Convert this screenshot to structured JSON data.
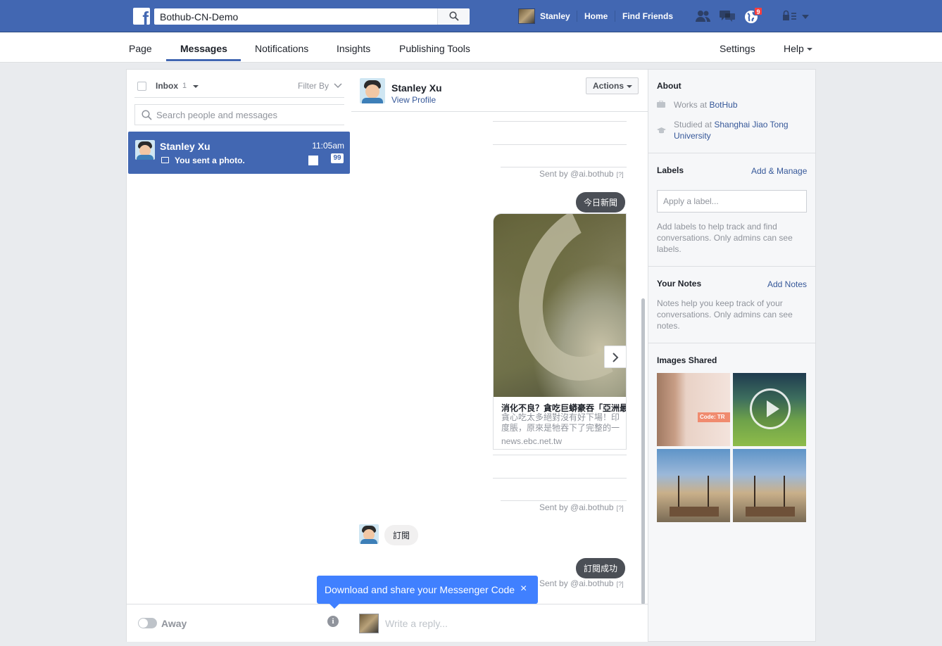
{
  "topbar": {
    "search_value": "Bothub-CN-Demo",
    "user_name": "Stanley",
    "home": "Home",
    "find_friends": "Find Friends",
    "notification_count": "9"
  },
  "subnav": {
    "tabs": [
      "Page",
      "Messages",
      "Notifications",
      "Insights",
      "Publishing Tools"
    ],
    "active_tab": "Messages",
    "settings": "Settings",
    "help": "Help"
  },
  "inbox": {
    "label": "Inbox",
    "count": "1",
    "filter": "Filter By",
    "search_placeholder": "Search people and messages",
    "conversations": [
      {
        "name": "Stanley Xu",
        "time": "11:05am",
        "snippet": "You sent a photo.",
        "badge": "99"
      }
    ],
    "status": "Away"
  },
  "conversation": {
    "name": "Stanley Xu",
    "view_profile": "View Profile",
    "actions": "Actions",
    "sent_by": "Sent by @ai.bothub",
    "sent_by_q": "[?]",
    "bubble_news": "今日新聞",
    "card": {
      "title": "消化不良？貪吃巨蟒豪吞「亞洲最",
      "desc": "貪心吃太多絕對沒有好下場！印度脹，原來是牠吞下了完整的一隻「",
      "domain": "news.ebc.net.tw"
    },
    "user_reply": "訂閱",
    "bubble_success": "訂閱成功",
    "reply_placeholder": "Write a reply..."
  },
  "tooltip": {
    "text": "Download and share your Messenger Code",
    "close": "×"
  },
  "about": {
    "title": "About",
    "works_prefix": "Works at ",
    "works_link": "BotHub",
    "studied_prefix": "Studied at ",
    "studied_link": "Shanghai Jiao Tong University"
  },
  "labels": {
    "title": "Labels",
    "manage": "Add & Manage",
    "placeholder": "Apply a label...",
    "help": "Add labels to help track and find conversations. Only admins can see labels."
  },
  "notes": {
    "title": "Your Notes",
    "add": "Add Notes",
    "help": "Notes help you keep track of your conversations. Only admins can see notes."
  },
  "images_shared": {
    "title": "Images Shared",
    "img1_tag": "Code: TR"
  },
  "colors": {
    "brand": "#4267b2",
    "link": "#365899",
    "tooltip": "#4080ff",
    "badge": "#fa3e3e"
  }
}
